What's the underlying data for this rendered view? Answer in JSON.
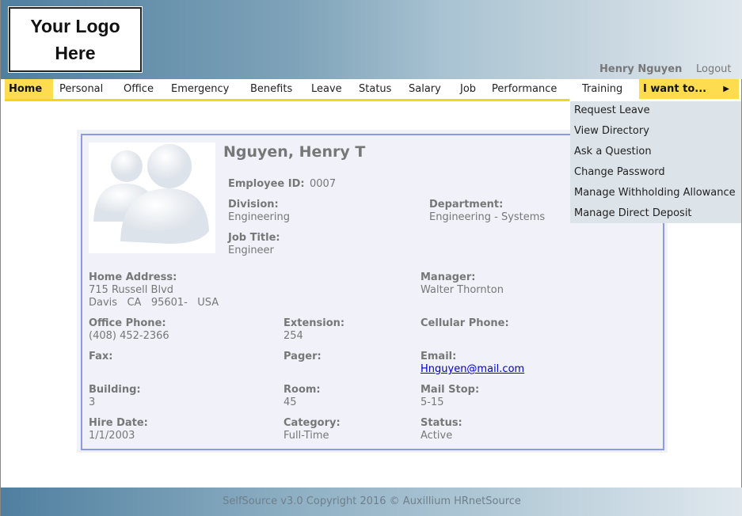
{
  "header": {
    "logo_text": "Your Logo Here",
    "user_name": "Henry Nguyen",
    "logout": "Logout"
  },
  "nav": {
    "items": [
      "Home",
      "Personal",
      "Office",
      "Emergency",
      "Benefits",
      "Leave",
      "Status",
      "Salary",
      "Job",
      "Performance",
      "Training"
    ],
    "i_want_to": "I want to..."
  },
  "dropdown": [
    "Request Leave",
    "View Directory",
    "Ask a Question",
    "Change Password",
    "Manage Withholding Allowance",
    "Manage Direct Deposit"
  ],
  "employee": {
    "name": "Nguyen, Henry T",
    "employee_id_label": "Employee ID:",
    "employee_id": "0007",
    "division_label": "Division:",
    "division": "Engineering",
    "department_label": "Department:",
    "department": "Engineering - Systems",
    "job_title_label": "Job Title:",
    "job_title": "Engineer",
    "home_address_label": "Home Address:",
    "address_line1": "715 Russell Blvd",
    "address_line2": "Davis   CA   95601-   USA",
    "manager_label": "Manager:",
    "manager": "Walter Thornton",
    "office_phone_label": "Office Phone:",
    "office_phone": "(408) 452-2366",
    "extension_label": "Extension:",
    "extension": "254",
    "cell_label": "Cellular Phone:",
    "fax_label": "Fax:",
    "pager_label": "Pager:",
    "email_label": "Email:",
    "email": "Hnguyen@mail.com",
    "building_label": "Building:",
    "building": "3",
    "room_label": "Room:",
    "room": "45",
    "mailstop_label": "Mail Stop:",
    "mailstop": "5-15",
    "hire_label": "Hire Date:",
    "hire_date": "1/1/2003",
    "category_label": "Category:",
    "category": "Full-Time",
    "status_label": "Status:",
    "status": "Active"
  },
  "footer": "SelfSource v3.0 Copyright 2016 © Auxillium HRnetSource"
}
